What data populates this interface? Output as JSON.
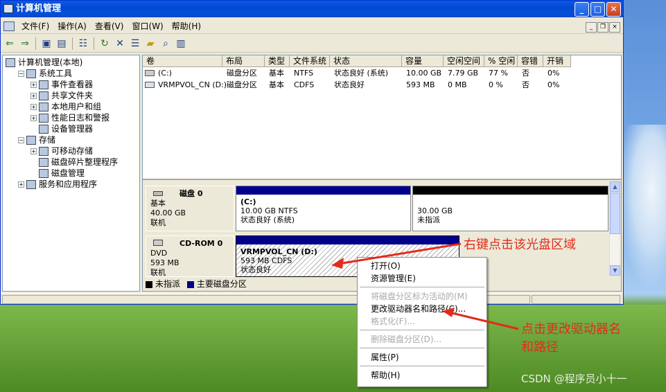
{
  "window": {
    "title": "计算机管理"
  },
  "menubar": {
    "items": [
      "文件(F)",
      "操作(A)",
      "查看(V)",
      "窗口(W)",
      "帮助(H)"
    ]
  },
  "mdi_controls": [
    "_",
    "❐",
    "×"
  ],
  "toolbar": {
    "icons": [
      "back-arrow-icon",
      "forward-arrow-icon",
      "up-folder-icon",
      "show-tree-icon",
      "properties-icon",
      "refresh-icon",
      "delete-icon",
      "properties-sheet-icon",
      "open-icon",
      "search-icon",
      "export-icon"
    ]
  },
  "tree": [
    {
      "label": "计算机管理(本地)",
      "level": 0,
      "exp": "",
      "icon": "computer-icon"
    },
    {
      "label": "系统工具",
      "level": 1,
      "exp": "−",
      "icon": "tools-icon"
    },
    {
      "label": "事件查看器",
      "level": 2,
      "exp": "+",
      "icon": "event-viewer-icon"
    },
    {
      "label": "共享文件夹",
      "level": 2,
      "exp": "+",
      "icon": "shared-folder-icon"
    },
    {
      "label": "本地用户和组",
      "level": 2,
      "exp": "+",
      "icon": "users-icon"
    },
    {
      "label": "性能日志和警报",
      "level": 2,
      "exp": "+",
      "icon": "performance-icon"
    },
    {
      "label": "设备管理器",
      "level": 2,
      "exp": "",
      "icon": "device-manager-icon"
    },
    {
      "label": "存储",
      "level": 1,
      "exp": "−",
      "icon": "storage-icon"
    },
    {
      "label": "可移动存储",
      "level": 2,
      "exp": "+",
      "icon": "removable-storage-icon"
    },
    {
      "label": "磁盘碎片整理程序",
      "level": 2,
      "exp": "",
      "icon": "defrag-icon"
    },
    {
      "label": "磁盘管理",
      "level": 2,
      "exp": "",
      "icon": "disk-management-icon"
    },
    {
      "label": "服务和应用程序",
      "level": 1,
      "exp": "+",
      "icon": "services-icon"
    }
  ],
  "volume_table": {
    "columns": [
      "卷",
      "布局",
      "类型",
      "文件系统",
      "状态",
      "容量",
      "空闲空间",
      "% 空闲",
      "容错",
      "开销"
    ],
    "rows": [
      [
        "(C:)",
        "磁盘分区",
        "基本",
        "NTFS",
        "状态良好 (系统)",
        "10.00 GB",
        "7.79 GB",
        "77 %",
        "否",
        "0%"
      ],
      [
        "VRMPVOL_CN (D:)",
        "磁盘分区",
        "基本",
        "CDFS",
        "状态良好",
        "593 MB",
        "0 MB",
        "0 %",
        "否",
        "0%"
      ]
    ]
  },
  "disks": [
    {
      "name": "磁盘 0",
      "type": "基本",
      "size": "40.00 GB",
      "status": "联机",
      "partitions": [
        {
          "title": "(C:)",
          "line1": "10.00 GB NTFS",
          "line2": "状态良好 (系统)"
        },
        {
          "title": "",
          "line1": "30.00 GB",
          "line2": "未指派"
        }
      ]
    },
    {
      "name": "CD-ROM 0",
      "type": "DVD",
      "size": "593 MB",
      "status": "联机",
      "partitions": [
        {
          "title": "VRMPVOL_CN (D:)",
          "line1": "593 MB CDFS",
          "line2": "状态良好"
        }
      ]
    }
  ],
  "legend": [
    {
      "label": "未指派",
      "color": "#000000"
    },
    {
      "label": "主要磁盘分区",
      "color": "#00008b"
    }
  ],
  "context_menu": [
    {
      "label": "打开(O)",
      "disabled": false
    },
    {
      "label": "资源管理(E)",
      "disabled": false
    },
    {
      "sep": true
    },
    {
      "label": "将磁盘分区标为活动的(M)",
      "disabled": true
    },
    {
      "label": "更改驱动器名和路径(C)...",
      "disabled": false
    },
    {
      "label": "格式化(F)...",
      "disabled": true
    },
    {
      "sep": true
    },
    {
      "label": "删除磁盘分区(D)...",
      "disabled": true
    },
    {
      "sep": true
    },
    {
      "label": "属性(P)",
      "disabled": false
    },
    {
      "sep": true
    },
    {
      "label": "帮助(H)",
      "disabled": false
    }
  ],
  "annotations": {
    "right_click": "右键点击该光盘区域",
    "click_change_1": "点击更改驱动器名",
    "click_change_2": "和路径"
  },
  "watermark": "CSDN @程序员小十一",
  "colors": {
    "annotation": "#e32b1b",
    "primary_partition": "#00008b",
    "unallocated": "#000000",
    "titlebar": "#0348d4"
  }
}
